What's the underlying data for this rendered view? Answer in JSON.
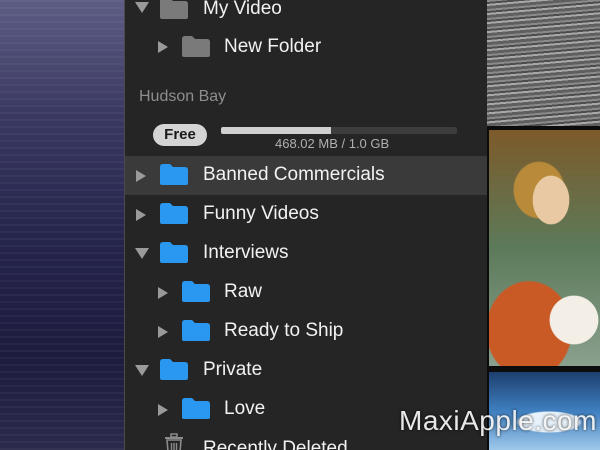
{
  "sidebar": {
    "section_title": "Hudson Bay",
    "storage": {
      "badge": "Free",
      "text": "468.02 MB / 1.0 GB",
      "used_fraction": 0.468
    },
    "items": [
      {
        "label": "My Video",
        "expanded": true
      },
      {
        "label": "New Folder",
        "expanded": false
      },
      {
        "label": "Banned Commercials",
        "expanded": false,
        "selected": true
      },
      {
        "label": "Funny Videos",
        "expanded": false
      },
      {
        "label": "Interviews",
        "expanded": true
      },
      {
        "label": "Raw",
        "expanded": false
      },
      {
        "label": "Ready to Ship",
        "expanded": false
      },
      {
        "label": "Private",
        "expanded": true
      },
      {
        "label": "Love",
        "expanded": false
      },
      {
        "label": "Recently Deleted"
      }
    ]
  },
  "watermark": "MaxiApple.com",
  "colors": {
    "sidebar_bg": "#252525",
    "folder_blue": "#2a97f0",
    "folder_gray": "#7a7a7a",
    "selected_row": "#3a3a3a"
  }
}
